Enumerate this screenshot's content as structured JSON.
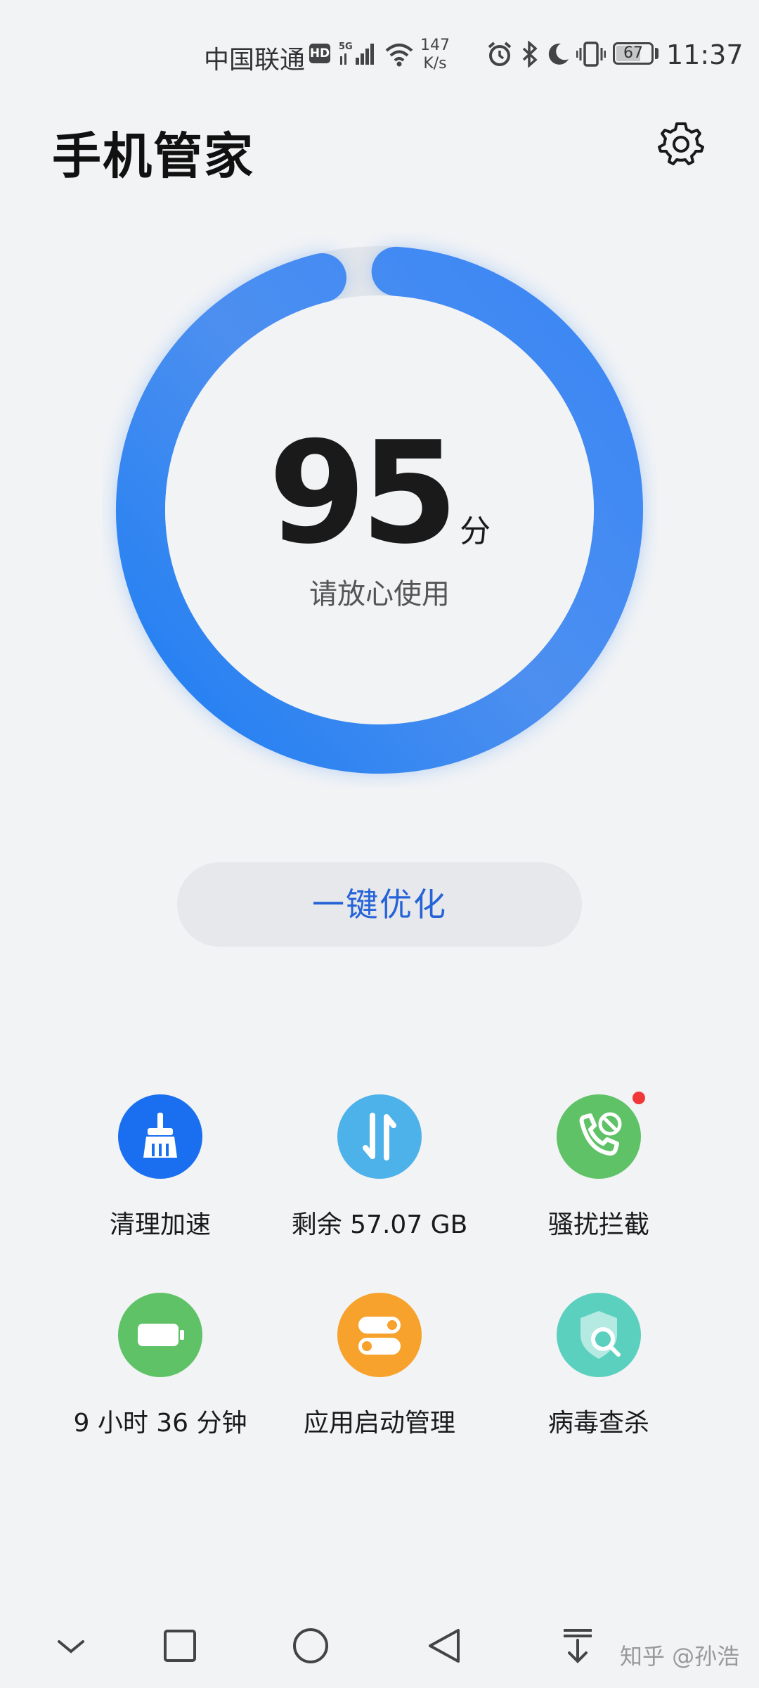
{
  "status_bar": {
    "carrier": "中国联通",
    "hd": "HD",
    "network": "5G",
    "speed_value": "147",
    "speed_unit": "K/s",
    "battery": "67",
    "time": "11:37",
    "icons": [
      "alarm-icon",
      "bluetooth-icon",
      "moon-icon",
      "vibrate-icon"
    ]
  },
  "header": {
    "title": "手机管家",
    "settings_icon": "gear-icon"
  },
  "score": {
    "value": "95",
    "unit": "分",
    "subtitle": "请放心使用",
    "progress": 0.95,
    "color": "#3d8bfa"
  },
  "optimize_button": {
    "label": "一键优化",
    "color": "#2563d9"
  },
  "tools": [
    {
      "label": "清理加速",
      "icon": "broom-icon",
      "color": "#1a6ef0"
    },
    {
      "label": "剩余 57.07 GB",
      "icon": "transfer-arrows-icon",
      "color": "#4db1ea"
    },
    {
      "label": "骚扰拦截",
      "icon": "blocked-call-icon",
      "color": "#5fc266",
      "badge": true
    },
    {
      "label": "9 小时 36 分钟",
      "icon": "battery-icon",
      "color": "#5fc266"
    },
    {
      "label": "应用启动管理",
      "icon": "toggle-icon",
      "color": "#f7a22c"
    },
    {
      "label": "病毒查杀",
      "icon": "shield-search-icon",
      "color": "#5bd0be"
    }
  ],
  "nav_bar": {
    "buttons": [
      "chevron-down-icon",
      "recents-icon",
      "home-icon",
      "back-icon",
      "download-icon"
    ]
  },
  "watermark": "知乎 @孙浩"
}
